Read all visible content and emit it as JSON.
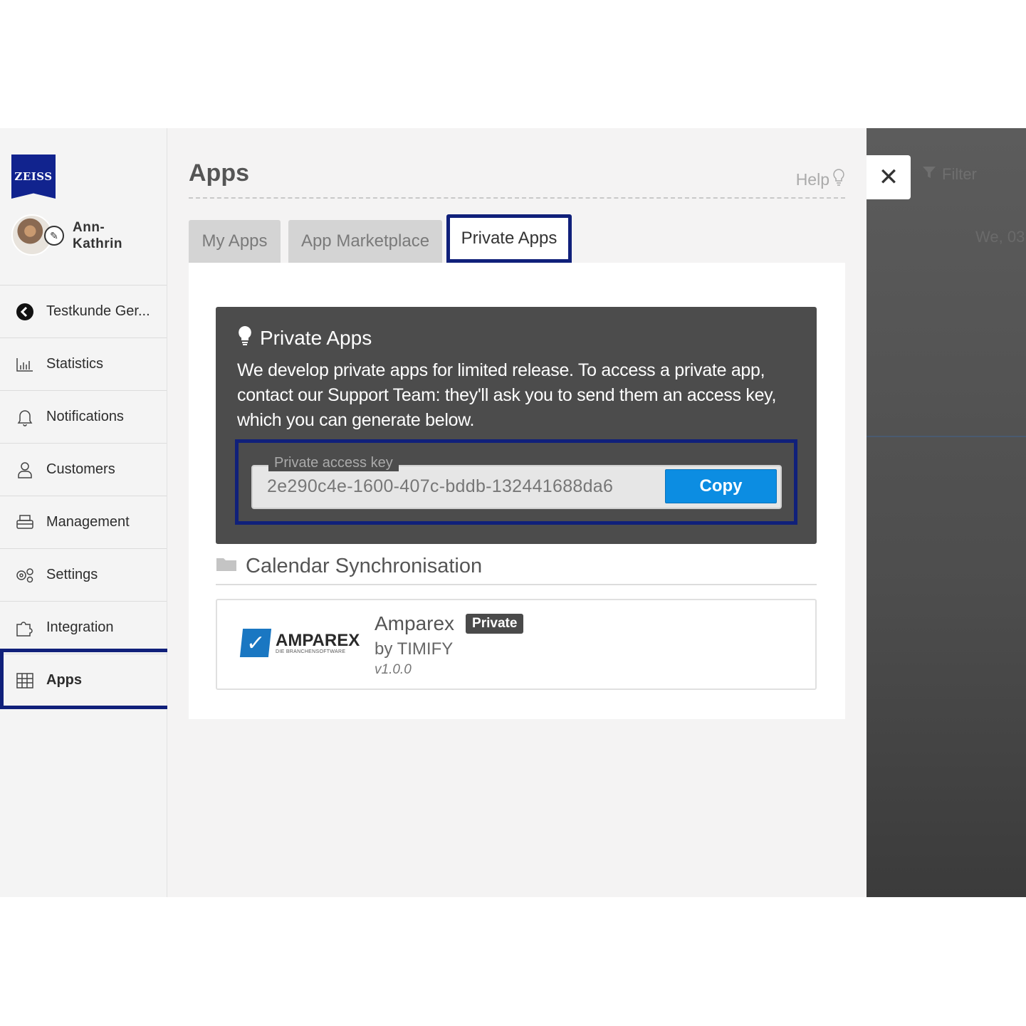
{
  "brand": {
    "logo_text": "ZEISS"
  },
  "user": {
    "name": "Ann-\nKathrin"
  },
  "nav": [
    {
      "label": "Testkunde Ger...",
      "icon": "back-circle-icon"
    },
    {
      "label": "Statistics",
      "icon": "bar-chart-icon"
    },
    {
      "label": "Notifications",
      "icon": "bell-icon"
    },
    {
      "label": "Customers",
      "icon": "person-icon"
    },
    {
      "label": "Management",
      "icon": "printer-icon"
    },
    {
      "label": "Settings",
      "icon": "gears-icon"
    },
    {
      "label": "Integration",
      "icon": "puzzle-icon"
    },
    {
      "label": "Apps",
      "icon": "grid-icon",
      "active": true
    }
  ],
  "page": {
    "title": "Apps",
    "help": "Help"
  },
  "tabs": [
    {
      "label": "My Apps"
    },
    {
      "label": "App Marketplace"
    },
    {
      "label": "Private Apps",
      "active": true
    }
  ],
  "info": {
    "title": "Private Apps",
    "text": "We develop private apps for limited release. To access a private app, contact our Support Team: they'll ask you to send them an access key, which you can generate below.",
    "key_label": "Private access key",
    "key_value": "2e290c4e-1600-407c-bddb-132441688da6",
    "copy_label": "Copy"
  },
  "section": {
    "title": "Calendar Synchronisation"
  },
  "app": {
    "logo_word": "AMPAREX",
    "logo_sub": "DIE BRANCHENSOFTWARE",
    "name": "Amparex",
    "badge": "Private",
    "by": "by TIMIFY",
    "version": "v1.0.0"
  },
  "overlay": {
    "close": "✕",
    "filter": "Filter",
    "date": "We, 03"
  },
  "colors": {
    "highlight": "#10207a",
    "copy_button": "#0c8de2",
    "brand": "#11238e"
  }
}
